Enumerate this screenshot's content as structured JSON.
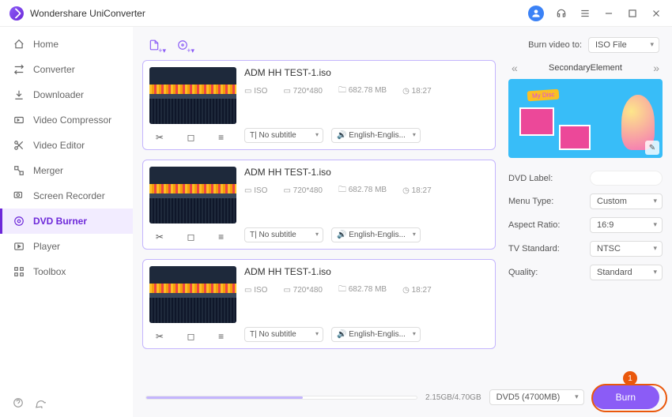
{
  "app_title": "Wondershare UniConverter",
  "sidebar": {
    "items": [
      {
        "icon": "home",
        "label": "Home"
      },
      {
        "icon": "convert",
        "label": "Converter"
      },
      {
        "icon": "download",
        "label": "Downloader"
      },
      {
        "icon": "compress",
        "label": "Video Compressor"
      },
      {
        "icon": "edit",
        "label": "Video Editor"
      },
      {
        "icon": "merge",
        "label": "Merger"
      },
      {
        "icon": "record",
        "label": "Screen Recorder"
      },
      {
        "icon": "burn",
        "label": "DVD Burner"
      },
      {
        "icon": "play",
        "label": "Player"
      },
      {
        "icon": "toolbox",
        "label": "Toolbox"
      }
    ],
    "active_index": 7
  },
  "top": {
    "burn_to_label": "Burn video to:",
    "burn_to_value": "ISO File"
  },
  "files": [
    {
      "name": "ADM HH TEST-1.iso",
      "format": "ISO",
      "resolution": "720*480",
      "size": "682.78 MB",
      "duration": "18:27",
      "subtitle": "No subtitle",
      "audio": "English-Englis..."
    },
    {
      "name": "ADM HH TEST-1.iso",
      "format": "ISO",
      "resolution": "720*480",
      "size": "682.78 MB",
      "duration": "18:27",
      "subtitle": "No subtitle",
      "audio": "English-Englis..."
    },
    {
      "name": "ADM HH TEST-1.iso",
      "format": "ISO",
      "resolution": "720*480",
      "size": "682.78 MB",
      "duration": "18:27",
      "subtitle": "No subtitle",
      "audio": "English-Englis..."
    }
  ],
  "theme": {
    "name": "SecondaryElement",
    "banner_text": "My Disc"
  },
  "settings": {
    "dvd_label_label": "DVD Label:",
    "dvd_label_value": "",
    "menu_type_label": "Menu Type:",
    "menu_type_value": "Custom",
    "aspect_label": "Aspect Ratio:",
    "aspect_value": "16:9",
    "tv_label": "TV Standard:",
    "tv_value": "NTSC",
    "quality_label": "Quality:",
    "quality_value": "Standard"
  },
  "footer": {
    "size_text": "2.15GB/4.70GB",
    "disc_type": "DVD5 (4700MB)",
    "burn_label": "Burn"
  },
  "annotation": "1"
}
